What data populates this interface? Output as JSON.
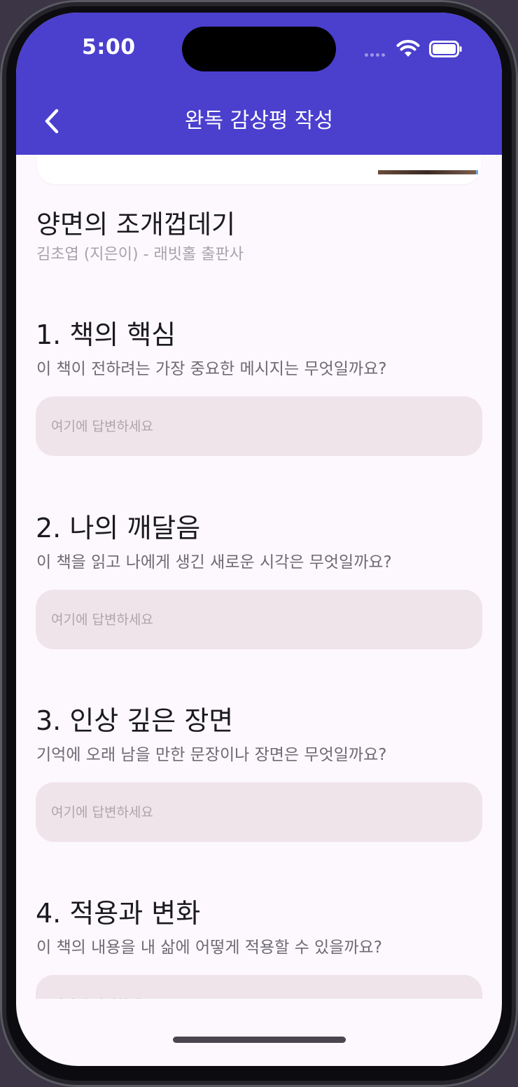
{
  "status_bar": {
    "time": "5:00",
    "icons": [
      "cellular-signal-icon",
      "wifi-icon",
      "battery-icon"
    ]
  },
  "header": {
    "title": "완독 감상평 작성",
    "back_icon": "chevron-left-icon",
    "background": "#4b3fce"
  },
  "book": {
    "title": "양면의 조개껍데기",
    "meta": "김초엽 (지은이) - 래빗홀 출판사"
  },
  "questions": [
    {
      "title": "1. 책의 핵심",
      "description": "이 책이 전하려는 가장 중요한 메시지는 무엇일까요?",
      "placeholder": "여기에 답변하세요",
      "value": ""
    },
    {
      "title": "2. 나의 깨달음",
      "description": "이 책을 읽고 나에게 생긴 새로운 시각은 무엇일까요?",
      "placeholder": "여기에 답변하세요",
      "value": ""
    },
    {
      "title": "3. 인상 깊은 장면",
      "description": "기억에 오래 남을 만한 문장이나 장면은 무엇일까요?",
      "placeholder": "여기에 답변하세요",
      "value": ""
    },
    {
      "title": "4. 적용과 변화",
      "description": "이 책의 내용을 내 삶에 어떻게 적용할 수 있을까요?",
      "placeholder": "여기에 답변하세요",
      "value": ""
    }
  ]
}
